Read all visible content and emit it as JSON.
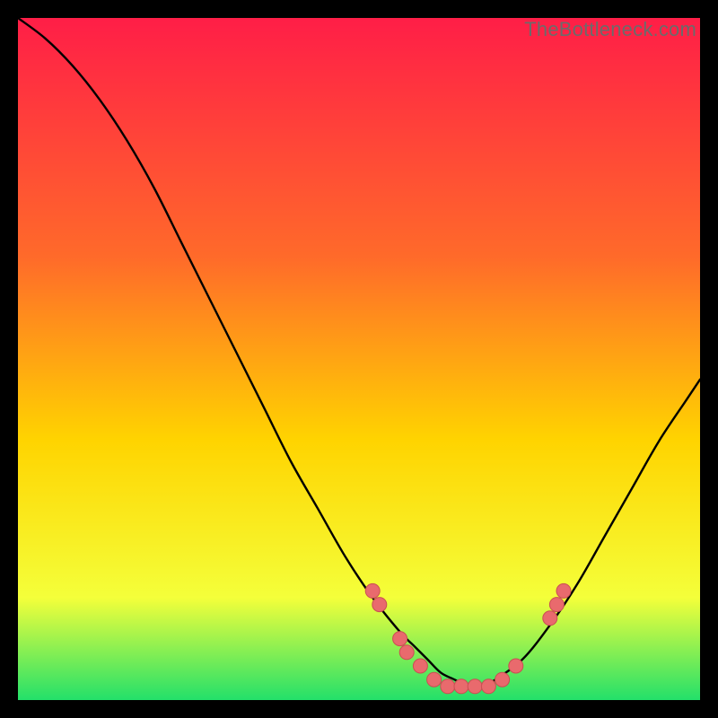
{
  "watermark": "TheBottleneck.com",
  "colors": {
    "gradient_top": "#ff1e47",
    "gradient_mid1": "#ff6a2a",
    "gradient_mid2": "#ffd400",
    "gradient_mid3": "#f4ff3a",
    "gradient_bottom": "#23e06a",
    "curve_stroke": "#000000",
    "marker_fill": "#e96a6d",
    "marker_stroke": "#c94f52",
    "frame_bg": "#000000"
  },
  "chart_data": {
    "type": "line",
    "title": "",
    "xlabel": "",
    "ylabel": "",
    "xlim": [
      0,
      100
    ],
    "ylim": [
      0,
      100
    ],
    "grid": false,
    "legend": false,
    "series": [
      {
        "name": "bottleneck-curve",
        "x": [
          0,
          4,
          8,
          12,
          16,
          20,
          24,
          28,
          32,
          36,
          40,
          44,
          48,
          52,
          56,
          58,
          60,
          62,
          64,
          66,
          68,
          70,
          74,
          78,
          82,
          86,
          90,
          94,
          98,
          100
        ],
        "y": [
          100,
          97,
          93,
          88,
          82,
          75,
          67,
          59,
          51,
          43,
          35,
          28,
          21,
          15,
          10,
          8,
          6,
          4,
          3,
          2,
          2,
          3,
          6,
          11,
          17,
          24,
          31,
          38,
          44,
          47
        ]
      }
    ],
    "markers": {
      "name": "highlight-points",
      "points": [
        {
          "x": 52,
          "y": 16
        },
        {
          "x": 53,
          "y": 14
        },
        {
          "x": 56,
          "y": 9
        },
        {
          "x": 57,
          "y": 7
        },
        {
          "x": 59,
          "y": 5
        },
        {
          "x": 61,
          "y": 3
        },
        {
          "x": 63,
          "y": 2
        },
        {
          "x": 65,
          "y": 2
        },
        {
          "x": 67,
          "y": 2
        },
        {
          "x": 69,
          "y": 2
        },
        {
          "x": 71,
          "y": 3
        },
        {
          "x": 73,
          "y": 5
        },
        {
          "x": 78,
          "y": 12
        },
        {
          "x": 79,
          "y": 14
        },
        {
          "x": 80,
          "y": 16
        }
      ]
    }
  }
}
